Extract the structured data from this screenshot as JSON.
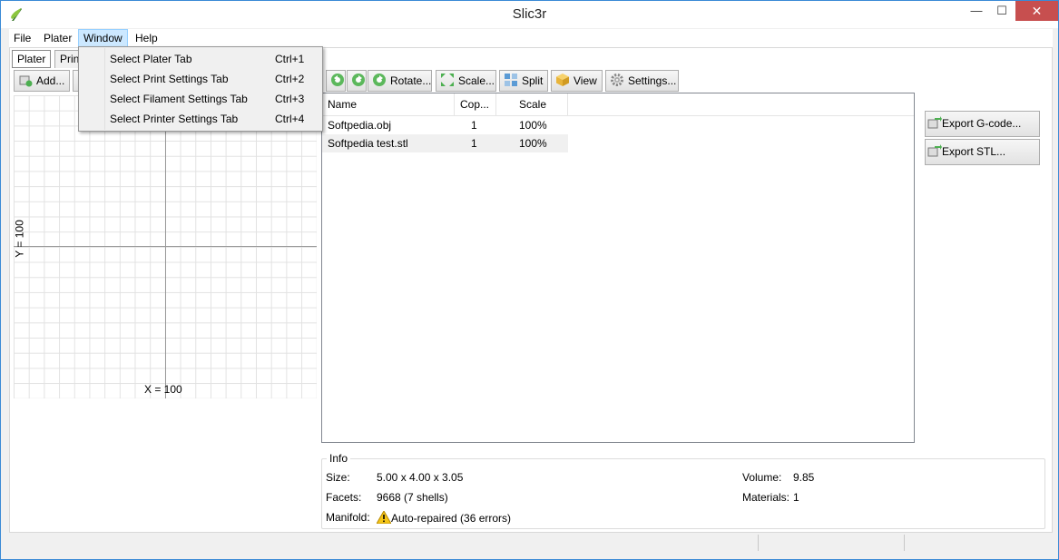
{
  "window": {
    "title": "Slic3r",
    "minimize": "—",
    "maximize": "☐",
    "close": "✕"
  },
  "menubar": {
    "items": [
      "File",
      "Plater",
      "Window",
      "Help"
    ]
  },
  "window_menu": {
    "items": [
      {
        "label": "Select Plater Tab",
        "shortcut": "Ctrl+1"
      },
      {
        "label": "Select Print Settings Tab",
        "shortcut": "Ctrl+2"
      },
      {
        "label": "Select Filament Settings Tab",
        "shortcut": "Ctrl+3"
      },
      {
        "label": "Select Printer Settings Tab",
        "shortcut": "Ctrl+4"
      }
    ]
  },
  "tabs": {
    "plater": "Plater",
    "print_partial": "Prin"
  },
  "toolbar": {
    "add": "Add...",
    "rotate": "Rotate...",
    "scale": "Scale...",
    "split": "Split",
    "view": "View",
    "settings": "Settings..."
  },
  "plater": {
    "ylabel": "Y = 100",
    "xlabel": "X = 100"
  },
  "objects": {
    "headers": {
      "name": "Name",
      "copies": "Cop...",
      "scale": "Scale"
    },
    "rows": [
      {
        "name": "Softpedia.obj",
        "copies": "1",
        "scale": "100%"
      },
      {
        "name": "Softpedia test.stl",
        "copies": "1",
        "scale": "100%"
      }
    ]
  },
  "export": {
    "gcode": "Export G-code...",
    "stl": "Export STL..."
  },
  "info": {
    "legend": "Info",
    "size_label": "Size:",
    "size_value": "5.00 x 4.00 x 3.05",
    "facets_label": "Facets:",
    "facets_value": "9668 (7 shells)",
    "manifold_label": "Manifold:",
    "manifold_value": "Auto-repaired (36 errors)",
    "volume_label": "Volume:",
    "volume_value": "9.85",
    "materials_label": "Materials:",
    "materials_value": "1"
  },
  "colors": {
    "menu_active": "#cce8ff",
    "close_button": "#c74f4f",
    "window_border": "#3a8ad6"
  }
}
